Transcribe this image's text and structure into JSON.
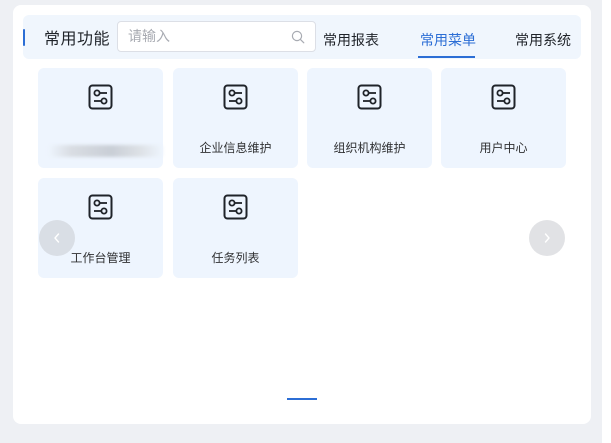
{
  "header": {
    "title": "常用功能",
    "search_placeholder": "请输入",
    "search_value": "",
    "tabs": [
      {
        "label": "常用报表",
        "active": false
      },
      {
        "label": "常用菜单",
        "active": true
      },
      {
        "label": "常用系统",
        "active": false
      }
    ]
  },
  "tiles": [
    {
      "label": "",
      "icon": "settings-sliders-icon",
      "obscured": true
    },
    {
      "label": "企业信息维护",
      "icon": "settings-sliders-icon"
    },
    {
      "label": "组织机构维护",
      "icon": "settings-sliders-icon"
    },
    {
      "label": "用户中心",
      "icon": "settings-sliders-icon"
    },
    {
      "label": "工作台管理",
      "icon": "settings-sliders-icon"
    },
    {
      "label": "任务列表",
      "icon": "settings-sliders-icon"
    }
  ],
  "carousel": {
    "prev_icon": "chevron-left-icon",
    "next_icon": "chevron-right-icon",
    "pages": 1,
    "current_page": 1
  },
  "colors": {
    "accent": "#2c6ed5",
    "tile_background": "#eef5fe",
    "header_background": "#f0f6fd"
  }
}
